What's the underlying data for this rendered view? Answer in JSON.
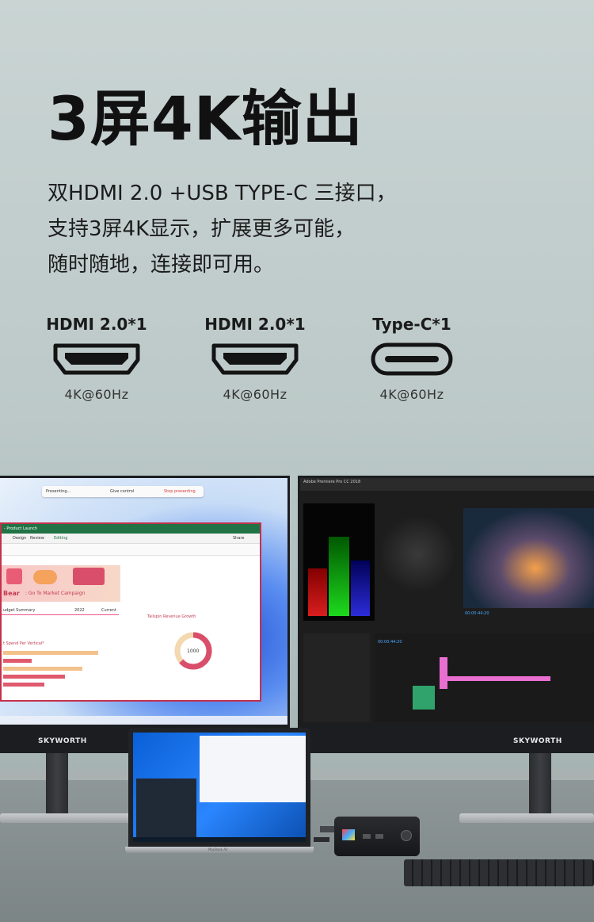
{
  "headline": "3屏4K输出",
  "description": [
    "双HDMI 2.0 +USB TYPE-C 三接口，",
    "支持3屏4K显示，扩展更多可能，",
    "随时随地，连接即可用。"
  ],
  "ports": [
    {
      "label": "HDMI 2.0*1",
      "icon": "hdmi-port-icon",
      "spec": "4K@60Hz"
    },
    {
      "label": "HDMI 2.0*1",
      "icon": "hdmi-port-icon",
      "spec": "4K@60Hz"
    },
    {
      "label": "Type-C*1",
      "icon": "usb-c-port-icon",
      "spec": "4K@60Hz"
    }
  ],
  "scene": {
    "monitor_left_brand": "SKYWORTH",
    "monitor_right_brand": "SKYWORTH",
    "presenting_bar": {
      "status": "Presenting...",
      "give_control": "Give control",
      "stop": "Stop presenting"
    },
    "excel": {
      "title": "- Product Launch",
      "menu": [
        "Design",
        "Review"
      ],
      "editing": "Editing",
      "share": "Share",
      "campaign": ": Go To Market Campaign",
      "campaign_brand": "Bear",
      "budget": "udget Summary",
      "year": "2022",
      "current": "Current",
      "spend": "t Spend Per Vertical*",
      "chart_title": "Tailspin Revenue Growth",
      "donut_value": "1000"
    },
    "premiere": {
      "title": "Adobe Premiere Pro CC 2018",
      "timecode_a": "00:00:44:20",
      "timecode_b": "00:00:44:20"
    },
    "laptop_brand": "MacBook Air",
    "accent_colors": {
      "excel_green": "#217346",
      "premiere_pink": "#e86fd0",
      "presenter_red": "#d63b3b"
    }
  }
}
